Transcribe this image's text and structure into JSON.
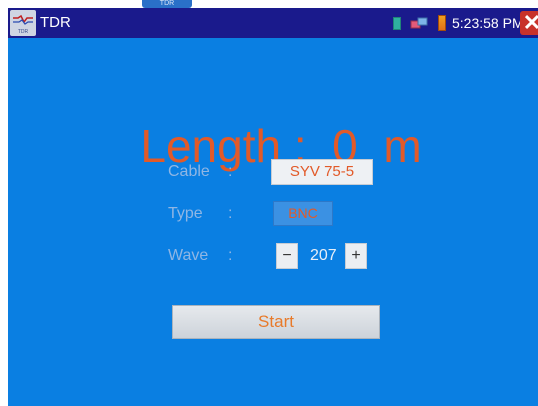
{
  "top_tab": {
    "label": "TDR"
  },
  "titlebar": {
    "app_icon_label": "TDR",
    "title": "TDR",
    "time": "5:23:58 PM",
    "close_glyph": "✕"
  },
  "main": {
    "length_text": "Length :  0  m",
    "cable": {
      "label": "Cable",
      "colon": ":",
      "value": "SYV 75-5"
    },
    "type": {
      "label": "Type",
      "colon": ":",
      "value": "BNC"
    },
    "wave": {
      "label": "Wave",
      "colon": ":",
      "minus": "−",
      "value": "207",
      "plus": "+"
    },
    "start_label": "Start"
  },
  "colors": {
    "titlebar_bg": "#1a1a8c",
    "main_bg": "#0a7fe2",
    "accent_orange": "#e25a28",
    "close_red": "#c8322a"
  },
  "icons": [
    "tdr-app-icon",
    "battery-icon",
    "connection-icon",
    "power-icon",
    "close-icon"
  ]
}
